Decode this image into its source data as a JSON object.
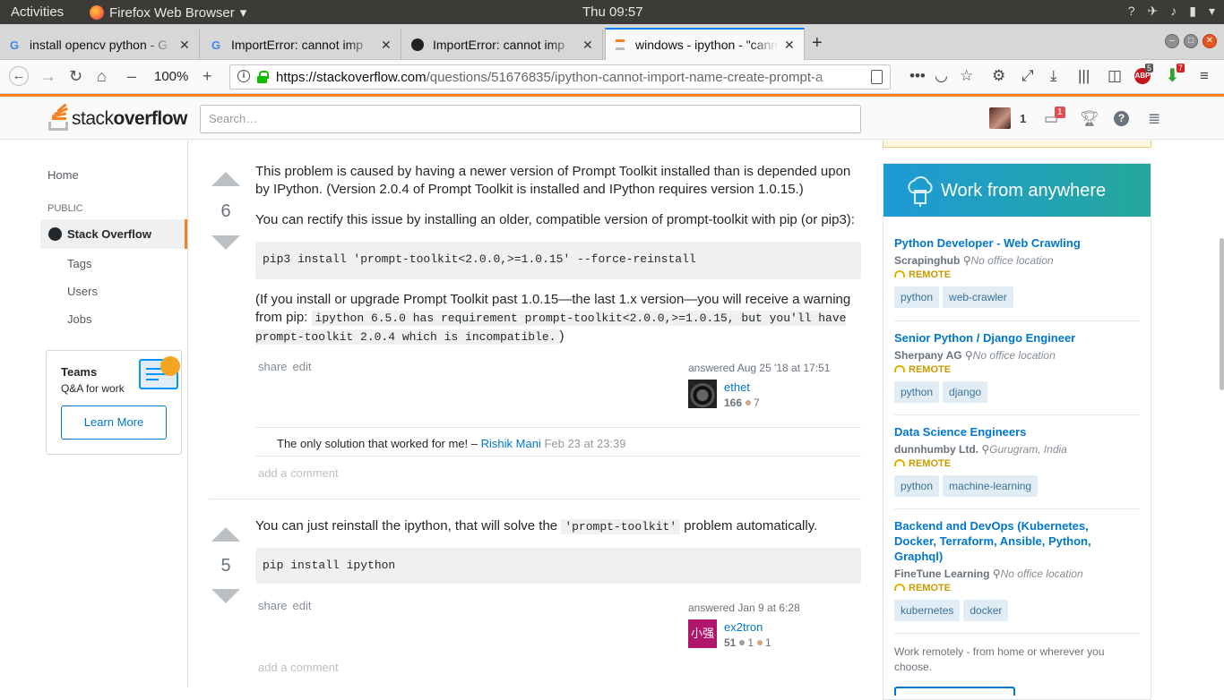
{
  "topbar": {
    "activities": "Activities",
    "app_name": "Firefox Web Browser",
    "clock": "Thu 09:57"
  },
  "tabs": [
    {
      "title": "install opencv python - G",
      "favicon": "G"
    },
    {
      "title": "ImportError: cannot imp",
      "favicon": "G"
    },
    {
      "title": "ImportError: cannot imp",
      "favicon": "github-icon"
    },
    {
      "title": "windows - ipython - \"cann",
      "favicon": "stackoverflow-icon"
    }
  ],
  "navbar": {
    "zoom": "100%",
    "url_host": "https://stackoverflow.com",
    "url_path": "/questions/51676835/ipython-cannot-import-name-create-prompt-a",
    "adblock_count": "5",
    "download_badge": "7"
  },
  "so_header": {
    "logo_light": "stack",
    "logo_bold": "overflow",
    "search_placeholder": "Search…",
    "reputation": "1",
    "inbox_count": "1"
  },
  "leftbar": {
    "home": "Home",
    "public": "PUBLIC",
    "stack_overflow": "Stack Overflow",
    "tags": "Tags",
    "users": "Users",
    "jobs": "Jobs",
    "teams_title": "Teams",
    "teams_subtitle": "Q&A for work",
    "learn_more": "Learn More"
  },
  "answer1": {
    "votes": "6",
    "p1": "This problem is caused by having a newer version of Prompt Toolkit installed than is depended upon by IPython. (Version 2.0.4 of Prompt Toolkit is installed and IPython requires version 1.0.15.)",
    "p2": "You can rectify this issue by installing an older, compatible version of prompt-toolkit with pip (or pip3):",
    "code": "pip3 install 'prompt-toolkit<2.0.0,>=1.0.15' --force-reinstall",
    "p3_start": "(If you install or upgrade Prompt Toolkit past 1.0.15—the last 1.x version—you will receive a warning from pip: ",
    "p3_code": "ipython 6.5.0 has requirement prompt-toolkit<2.0.0,>=1.0.15, but you'll have prompt-toolkit 2.0.4 which is incompatible.",
    "p3_end": ")",
    "share": "share",
    "edit": "edit",
    "answered": "answered Aug 25 '18 at 17:51",
    "user": "ethet",
    "rep": "166",
    "bronze": "7",
    "comment_text": "The only solution that worked for me! – ",
    "comment_user": "Rishik Mani",
    "comment_date": "Feb 23 at 23:39",
    "add_comment": "add a comment"
  },
  "answer2": {
    "votes": "5",
    "p1_start": "You can just reinstall the ipython, that will solve the ",
    "p1_code": "'prompt-toolkit'",
    "p1_end": " problem automatically.",
    "code": "pip install ipython",
    "share": "share",
    "edit": "edit",
    "answered": "answered Jan 9 at 6:28",
    "user": "ex2tron",
    "avatar_text": "小强",
    "rep": "51",
    "silver": "1",
    "bronze": "1",
    "add_comment": "add a comment"
  },
  "jobs": {
    "header": "Work from anywhere",
    "listings": [
      {
        "title": "Python Developer - Web Crawling",
        "company": "Scrapinghub",
        "location": "No office location",
        "remote": "REMOTE",
        "tags": [
          "python",
          "web-crawler"
        ]
      },
      {
        "title": "Senior Python / Django Engineer",
        "company": "Sherpany AG",
        "location": "No office location",
        "remote": "REMOTE",
        "tags": [
          "python",
          "django"
        ]
      },
      {
        "title": "Data Science Engineers",
        "company": "dunnhumby Ltd.",
        "location": "Gurugram, India",
        "remote": "REMOTE",
        "tags": [
          "python",
          "machine-learning"
        ]
      },
      {
        "title": "Backend and DevOps (Kubernetes, Docker, Terraform, Ansible, Python, Graphql)",
        "company": "FineTune Learning",
        "location": "No office location",
        "remote": "REMOTE",
        "tags": [
          "kubernetes",
          "docker"
        ]
      }
    ],
    "footer": "Work remotely - from home or wherever you choose."
  },
  "colors": {
    "so_orange": "#f48024",
    "link_blue": "#0077cc",
    "tag_bg": "#e1ecf4"
  }
}
